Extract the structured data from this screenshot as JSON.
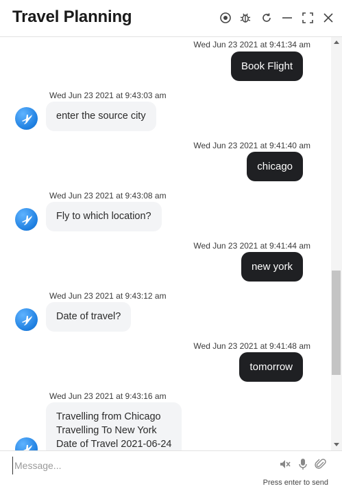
{
  "header": {
    "title": "Travel Planning",
    "icons": [
      "record-icon",
      "bug-icon",
      "refresh-icon",
      "minimize-icon",
      "fullscreen-icon",
      "close-icon"
    ]
  },
  "messages": [
    {
      "sender": "user",
      "timestamp": "Wed Jun 23 2021 at 9:41:34 am",
      "text": "Book Flight"
    },
    {
      "sender": "bot",
      "timestamp": "Wed Jun 23 2021 at 9:43:03 am",
      "text": "enter the source city"
    },
    {
      "sender": "user",
      "timestamp": "Wed Jun 23 2021 at 9:41:40 am",
      "text": "chicago"
    },
    {
      "sender": "bot",
      "timestamp": "Wed Jun 23 2021 at 9:43:08 am",
      "text": "Fly to which location?"
    },
    {
      "sender": "user",
      "timestamp": "Wed Jun 23 2021 at 9:41:44 am",
      "text": "new york"
    },
    {
      "sender": "bot",
      "timestamp": "Wed Jun 23 2021 at 9:43:12 am",
      "text": "Date of travel?"
    },
    {
      "sender": "user",
      "timestamp": "Wed Jun 23 2021 at 9:41:48 am",
      "text": "tomorrow"
    },
    {
      "sender": "bot",
      "timestamp": "Wed Jun 23 2021 at 9:43:16 am",
      "lines": [
        "Travelling from Chicago",
        "Travelling To New York",
        "Date of Travel 2021-06-24"
      ]
    }
  ],
  "composer": {
    "placeholder": "Message...",
    "hint": "Press enter to send",
    "icons": [
      "mute-icon",
      "microphone-icon",
      "paperclip-icon"
    ]
  },
  "colors": {
    "user_bubble": "#1f2023",
    "bot_bubble": "#f3f4f6",
    "avatar": "#1e7fe0"
  }
}
